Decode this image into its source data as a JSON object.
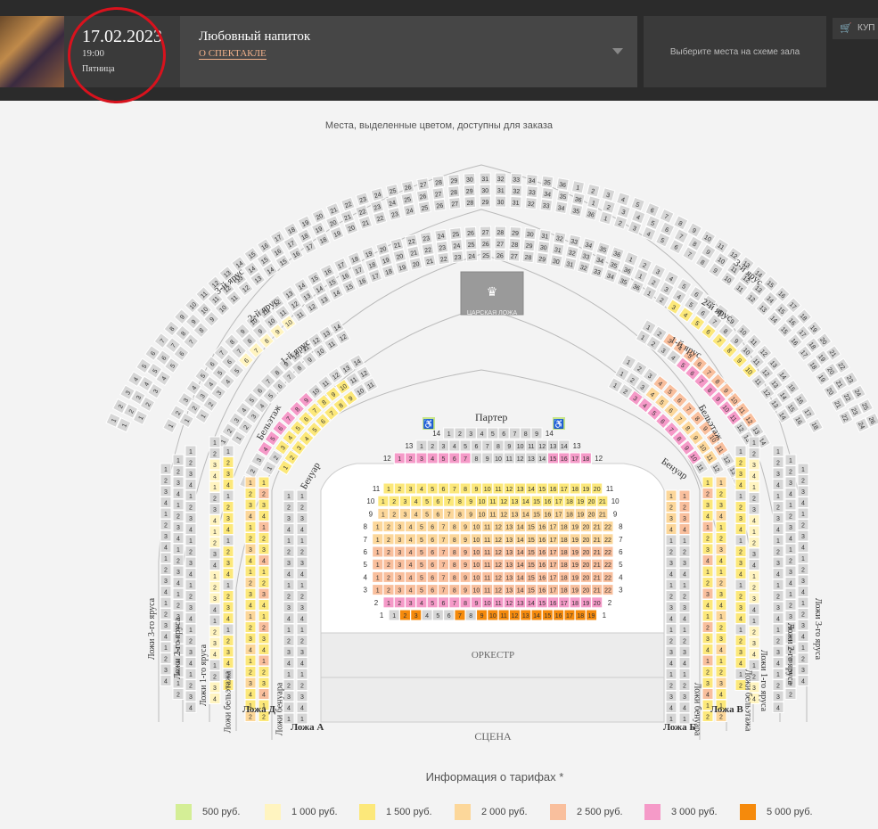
{
  "header": {
    "date": "17.02.2023",
    "time": "19:00",
    "weekday": "Пятница",
    "show_title": "Любовный напиток",
    "about_link": "О СПЕКТАКЛЕ",
    "choose_prompt": "Выберите места на схеме зала",
    "buy_label": "КУП"
  },
  "hint": "Места, выделенные цветом, доступны для заказа",
  "hall": {
    "tier3": "3-й ярус",
    "tier2": "2-й ярус",
    "tier1": "1-й ярус",
    "belletage": "Бельэтаж",
    "benoir": "Бенуар",
    "parterre": "Партер",
    "royal_box": "ЦАРСКАЯ ЛОЖА",
    "orchestra": "ОРКЕСТР",
    "stage": "СЦЕНА",
    "box_a": "Ложа А",
    "box_b": "Ложа Б",
    "box_v": "Ложа В",
    "box_d": "Ложа Д",
    "boxes_tier3": "Ложи 3-го яруса",
    "boxes_tier2": "Ложи 2-го яруса",
    "boxes_tier1": "Ложи 1-го яруса",
    "boxes_belletage": "Ложи бельэтажа",
    "boxes_benoir": "Ложи бенуара"
  },
  "colors": {
    "unavailable": "#d6d6d6",
    "p500": "#d4ee96",
    "p1000": "#fff4c0",
    "p1500": "#fce87a",
    "p2000": "#fcd79a",
    "p2500": "#f9bf9d",
    "p3000": "#f59ac8",
    "p5000": "#f58a0c"
  },
  "tariffs": {
    "title": "Информация о тарифах *",
    "items": [
      {
        "label": "500 руб.",
        "color": "#d4ee96"
      },
      {
        "label": "1 000 руб.",
        "color": "#fff4c0"
      },
      {
        "label": "1 500 руб.",
        "color": "#fce87a"
      },
      {
        "label": "2 000 руб.",
        "color": "#fcd79a"
      },
      {
        "label": "2 500 руб.",
        "color": "#f9bf9d"
      },
      {
        "label": "3 000 руб.",
        "color": "#f59ac8"
      },
      {
        "label": "5 000 руб.",
        "color": "#f58a0c"
      }
    ]
  },
  "parterre_rows": [
    {
      "row": "12",
      "seats": 18,
      "price": [
        "p3000",
        "p3000",
        "p3000",
        "p3000",
        "p3000",
        "p3000",
        "p3000",
        "na",
        "na",
        "na",
        "na",
        "na",
        "na",
        "na",
        "p3000",
        "p3000",
        "p3000",
        "p3000"
      ]
    },
    {
      "row": "11",
      "seats": 20,
      "price": "p1500"
    },
    {
      "row": "10",
      "seats": 21,
      "price": "p1500"
    },
    {
      "row": "9",
      "seats": 21,
      "price": "p2000"
    },
    {
      "row": "8",
      "seats": 22,
      "price": "p2000"
    },
    {
      "row": "7",
      "seats": 22,
      "price": "p2000"
    },
    {
      "row": "6",
      "seats": 22,
      "price": "p2500"
    },
    {
      "row": "5",
      "seats": 22,
      "price": "p2500"
    },
    {
      "row": "4",
      "seats": 22,
      "price": "p2500"
    },
    {
      "row": "3",
      "seats": 22,
      "price": "p2500"
    },
    {
      "row": "2",
      "seats": 20,
      "price": "p3000"
    },
    {
      "row": "1",
      "seats": 19,
      "price": [
        "na",
        "p5000",
        "p5000",
        "na",
        "na",
        "na",
        "p5000",
        "na",
        "p5000",
        "p5000",
        "p5000",
        "p5000",
        "p5000",
        "p5000",
        "p5000",
        "p5000",
        "p5000",
        "p5000",
        "p5000"
      ]
    }
  ],
  "upper_rows": [
    {
      "row": "13",
      "seats": 14,
      "price": "na"
    },
    {
      "row": "14",
      "seats": 9,
      "price": "na"
    }
  ]
}
